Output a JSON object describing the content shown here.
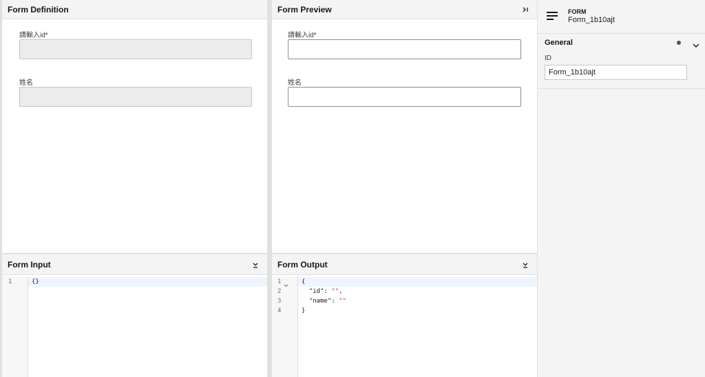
{
  "definition": {
    "title": "Form Definition",
    "fields": [
      {
        "label": "請輸入id*"
      },
      {
        "label": "姓名"
      }
    ]
  },
  "preview": {
    "title": "Form Preview",
    "collapse_icon": "collapse-right-icon",
    "fields": [
      {
        "label": "請輸入id*",
        "value": ""
      },
      {
        "label": "姓名",
        "value": ""
      }
    ]
  },
  "input": {
    "title": "Form Input",
    "collapse_icon": "collapse-down-icon",
    "lines": [
      {
        "num": "1",
        "text": "{}"
      }
    ]
  },
  "output": {
    "title": "Form Output",
    "collapse_icon": "collapse-down-icon",
    "fold_icon": "chevron-down-icon",
    "lines": [
      {
        "num": "1",
        "text": "{"
      },
      {
        "num": "2",
        "key": "\"id\"",
        "sep": ": ",
        "val": "\"\"",
        "end": ","
      },
      {
        "num": "3",
        "key": "\"name\"",
        "sep": ": ",
        "val": "\"\"",
        "end": ""
      },
      {
        "num": "4",
        "text": "}"
      }
    ]
  },
  "properties": {
    "type": "FORM",
    "name": "Form_1b10ajt",
    "type_icon": "form-lines-icon",
    "section": {
      "title": "General",
      "indicator_icon": "dot-icon",
      "toggle_icon": "chevron-down-icon"
    },
    "id_label": "ID",
    "id_value": "Form_1b10ajt"
  },
  "colors": {
    "panel_bg": "#ffffff",
    "header_bg": "#f4f4f4",
    "divider": "#e0e0e0",
    "string_red": "#da1e28"
  }
}
